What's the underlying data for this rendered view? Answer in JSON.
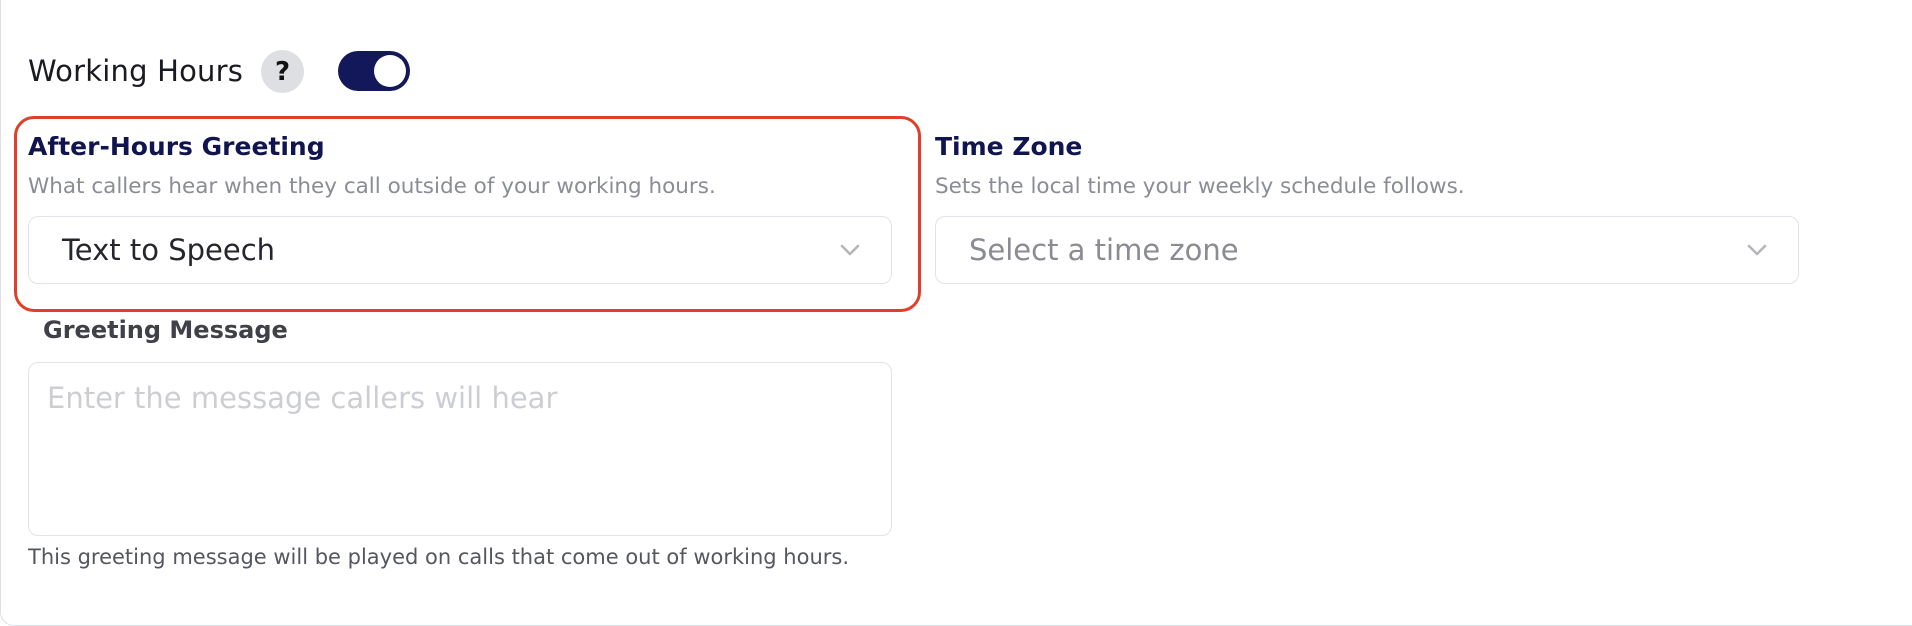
{
  "header": {
    "title": "Working Hours",
    "help_icon": "question-mark-icon",
    "toggle_state": "on"
  },
  "after_hours": {
    "title": "After-Hours Greeting",
    "help": "What callers hear when they call outside of your working hours.",
    "selected": "Text to Speech",
    "chevron_icon": "chevron-down-icon"
  },
  "time_zone": {
    "title": "Time Zone",
    "help": "Sets the local time your weekly schedule follows.",
    "placeholder": "Select a time zone",
    "chevron_icon": "chevron-down-icon"
  },
  "greeting": {
    "label": "Greeting Message",
    "placeholder": "Enter the message callers will hear",
    "footnote": "This greeting message will be played on calls that come out of working hours."
  },
  "colors": {
    "accent_navy": "#12185a",
    "highlight_red": "#e0402a",
    "title_navy": "#101550"
  }
}
